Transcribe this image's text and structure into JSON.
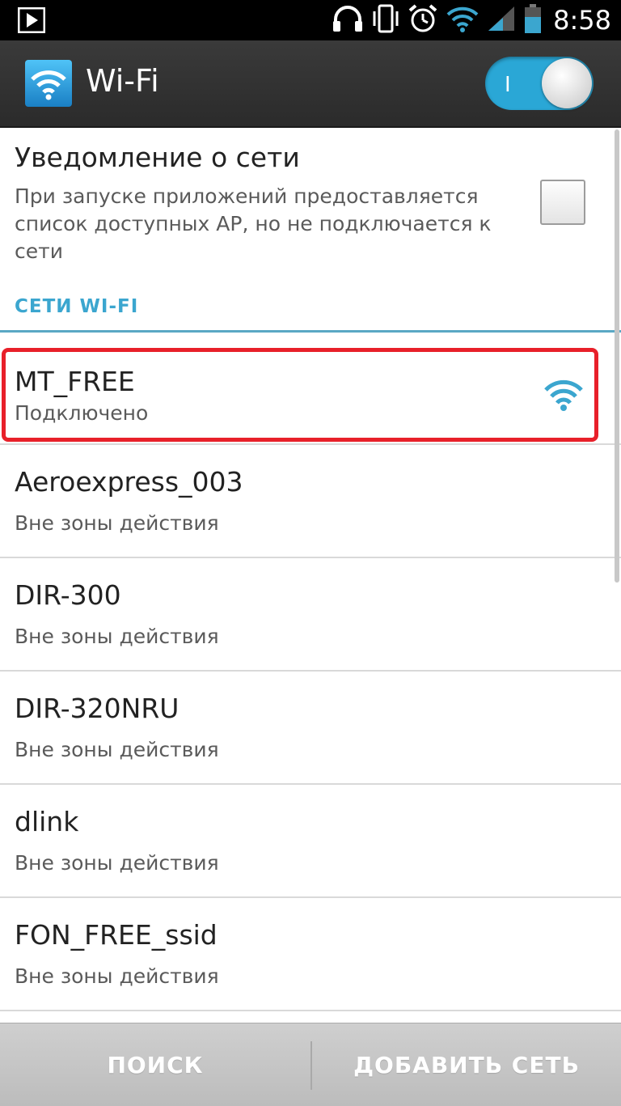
{
  "status_bar": {
    "time": "8:58",
    "icons": [
      "play-icon",
      "headphones-icon",
      "phone-vibrate-icon",
      "alarm-icon",
      "wifi-signal-icon",
      "cell-signal-icon",
      "battery-icon"
    ]
  },
  "action_bar": {
    "title": "Wi-Fi",
    "icon": "wifi-settings-icon",
    "toggle_state": "I",
    "toggle_on": true
  },
  "network_notification": {
    "title": "Уведомление о сети",
    "description": "При запуске приложений предоставляется список доступных AP, но не подключается к сети",
    "checked": false
  },
  "section": {
    "header": "СЕТИ WI-FI"
  },
  "networks": [
    {
      "ssid": "MT_FREE",
      "status": "Подключено"
    },
    {
      "ssid": "Aeroexpress_003",
      "status": "Вне зоны действия"
    },
    {
      "ssid": "DIR-300",
      "status": "Вне зоны действия"
    },
    {
      "ssid": "DIR-320NRU",
      "status": "Вне зоны действия"
    },
    {
      "ssid": "dlink",
      "status": "Вне зоны действия"
    },
    {
      "ssid": "FON_FREE_ssid",
      "status": "Вне зоны действия"
    }
  ],
  "bottom_bar": {
    "search_label": "ПОИСК",
    "add_network_label": "ДОБАВИТЬ СЕТЬ"
  },
  "colors": {
    "accent": "#3ba6cf",
    "toggle": "#2aa7d6",
    "highlight": "#e8202a"
  }
}
